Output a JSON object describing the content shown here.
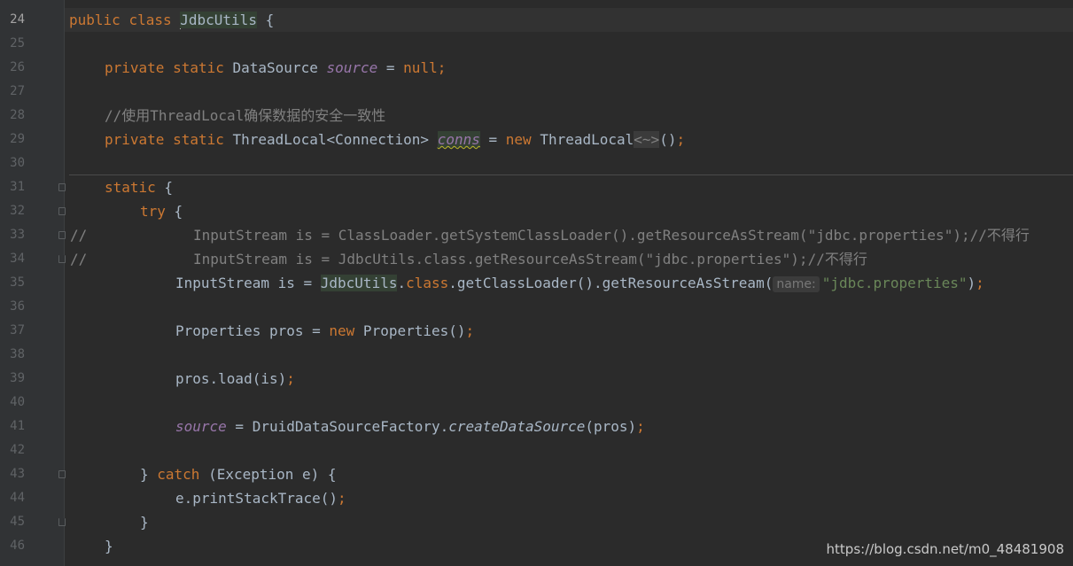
{
  "lines": [
    {
      "num": "24",
      "tokens": [
        {
          "t": "public",
          "c": "kw"
        },
        {
          "t": " "
        },
        {
          "t": "class",
          "c": "kw"
        },
        {
          "t": " "
        },
        {
          "t": "JdbcUtils",
          "c": "hl",
          "caret": true
        },
        {
          "t": " {"
        }
      ]
    },
    {
      "num": "25",
      "tokens": []
    },
    {
      "num": "26",
      "tokens": [
        {
          "t": "private",
          "c": "kw"
        },
        {
          "t": " "
        },
        {
          "t": "static",
          "c": "kw"
        },
        {
          "t": " DataSource "
        },
        {
          "t": "source",
          "c": "field"
        },
        {
          "t": " = "
        },
        {
          "t": "null",
          "c": "kw"
        },
        {
          "t": ";",
          "c": "kw"
        }
      ]
    },
    {
      "num": "27",
      "tokens": []
    },
    {
      "num": "28",
      "tokens": [
        {
          "t": "//使用ThreadLocal确保数据的安全一致性",
          "c": "cmt"
        }
      ]
    },
    {
      "num": "29",
      "tokens": [
        {
          "t": "private",
          "c": "kw"
        },
        {
          "t": " "
        },
        {
          "t": "static",
          "c": "kw"
        },
        {
          "t": " ThreadLocal<Connection> "
        },
        {
          "t": "conns",
          "c": "field hl warn"
        },
        {
          "t": " = "
        },
        {
          "t": "new",
          "c": "kw"
        },
        {
          "t": " ThreadLocal"
        },
        {
          "t": "<~>",
          "c": "diamond"
        },
        {
          "t": "()"
        },
        {
          "t": ";",
          "c": "kw"
        }
      ]
    },
    {
      "num": "30",
      "tokens": []
    },
    {
      "num": "31",
      "tokens": [
        {
          "t": "static",
          "c": "kw"
        },
        {
          "t": " {"
        }
      ]
    },
    {
      "num": "32",
      "tokens": [
        {
          "t": "try",
          "c": "kw"
        },
        {
          "t": " {"
        }
      ]
    },
    {
      "num": "33",
      "tokens": [
        {
          "t": "InputStream is = ClassLoader.getSystemClassLoader().getResourceAsStream(\"jdbc.properties\");//不得行",
          "c": "cmt"
        }
      ]
    },
    {
      "num": "34",
      "tokens": [
        {
          "t": "InputStream is = JdbcUtils.class.getResourceAsStream(\"jdbc.properties\");//不得行",
          "c": "cmt"
        }
      ]
    },
    {
      "num": "35",
      "tokens": [
        {
          "t": "InputStream is = "
        },
        {
          "t": "JdbcUtils",
          "c": "hl"
        },
        {
          "t": "."
        },
        {
          "t": "class",
          "c": "kw"
        },
        {
          "t": ".getClassLoader().getResourceAsStream("
        },
        {
          "t": "name:",
          "c": "hint"
        },
        {
          "t": "\"jdbc.properties\"",
          "c": "str"
        },
        {
          "t": ")"
        },
        {
          "t": ";",
          "c": "kw"
        }
      ]
    },
    {
      "num": "36",
      "tokens": []
    },
    {
      "num": "37",
      "tokens": [
        {
          "t": "Properties pros = "
        },
        {
          "t": "new",
          "c": "kw"
        },
        {
          "t": " Properties()"
        },
        {
          "t": ";",
          "c": "kw"
        }
      ]
    },
    {
      "num": "38",
      "tokens": []
    },
    {
      "num": "39",
      "tokens": [
        {
          "t": "pros.load(is)"
        },
        {
          "t": ";",
          "c": "kw"
        }
      ]
    },
    {
      "num": "40",
      "tokens": []
    },
    {
      "num": "41",
      "tokens": [
        {
          "t": "source",
          "c": "field"
        },
        {
          "t": " = DruidDataSourceFactory."
        },
        {
          "t": "createDataSource",
          "c": "static-call"
        },
        {
          "t": "(pros)"
        },
        {
          "t": ";",
          "c": "kw"
        }
      ]
    },
    {
      "num": "42",
      "tokens": []
    },
    {
      "num": "43",
      "tokens": [
        {
          "t": "} "
        },
        {
          "t": "catch",
          "c": "kw"
        },
        {
          "t": " (Exception e) {"
        }
      ]
    },
    {
      "num": "44",
      "tokens": [
        {
          "t": "e.printStackTrace()"
        },
        {
          "t": ";",
          "c": "kw"
        }
      ]
    },
    {
      "num": "45",
      "tokens": [
        {
          "t": "}"
        }
      ]
    },
    {
      "num": "46",
      "tokens": [
        {
          "t": "}"
        }
      ]
    }
  ],
  "gutter_comments": {
    "33": "//",
    "34": "//"
  },
  "watermark": "https://blog.csdn.net/m0_48481908",
  "colors": {
    "background": "#2b2b2b",
    "gutter": "#313335",
    "keyword": "#cc7832",
    "field": "#9876aa",
    "string": "#6a8759",
    "comment": "#808080",
    "text": "#a9b7c6"
  }
}
